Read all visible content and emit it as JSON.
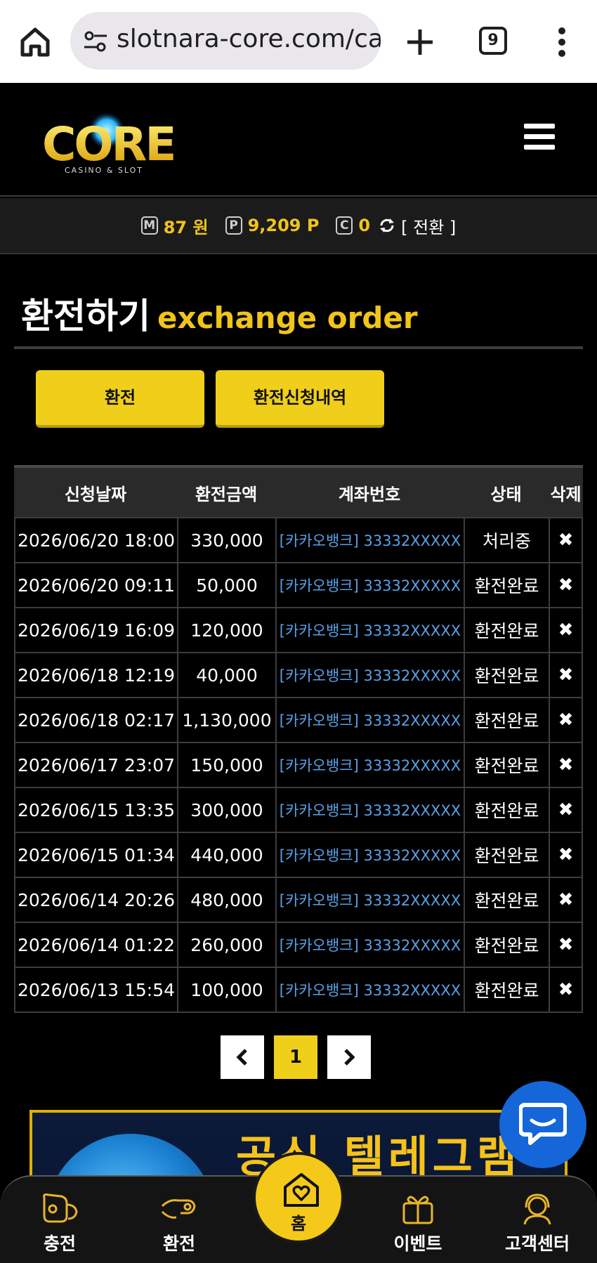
{
  "browser": {
    "url": "slotnara-core.com/ca",
    "tab_count": "9"
  },
  "header": {
    "logo_text": "CORE",
    "logo_sub": "CASINO & SLOT"
  },
  "balance": {
    "money_icon": "M",
    "money": "87 원",
    "point_icon": "P",
    "point": "9,209 P",
    "coin_icon": "C",
    "coin": "0",
    "switch_label": "[ 전환 ]"
  },
  "title": {
    "ko": "환전하기",
    "en": "exchange order"
  },
  "tabs": {
    "exchange": "환전",
    "history": "환전신청내역"
  },
  "table": {
    "headers": [
      "신청날짜",
      "환전금액",
      "계좌번호",
      "상태",
      "삭제"
    ],
    "rows": [
      {
        "date": "2026/06/20 18:00",
        "amount": "330,000",
        "account": "[카카오뱅크] 33332XXXXX",
        "status": "처리중"
      },
      {
        "date": "2026/06/20 09:11",
        "amount": "50,000",
        "account": "[카카오뱅크] 33332XXXXX",
        "status": "환전완료"
      },
      {
        "date": "2026/06/19 16:09",
        "amount": "120,000",
        "account": "[카카오뱅크] 33332XXXXX",
        "status": "환전완료"
      },
      {
        "date": "2026/06/18 12:19",
        "amount": "40,000",
        "account": "[카카오뱅크] 33332XXXXX",
        "status": "환전완료"
      },
      {
        "date": "2026/06/18 02:17",
        "amount": "1,130,000",
        "account": "[카카오뱅크] 33332XXXXX",
        "status": "환전완료"
      },
      {
        "date": "2026/06/17 23:07",
        "amount": "150,000",
        "account": "[카카오뱅크] 33332XXXXX",
        "status": "환전완료"
      },
      {
        "date": "2026/06/15 13:35",
        "amount": "300,000",
        "account": "[카카오뱅크] 33332XXXXX",
        "status": "환전완료"
      },
      {
        "date": "2026/06/15 01:34",
        "amount": "440,000",
        "account": "[카카오뱅크] 33332XXXXX",
        "status": "환전완료"
      },
      {
        "date": "2026/06/14 20:26",
        "amount": "480,000",
        "account": "[카카오뱅크] 33332XXXXX",
        "status": "환전완료"
      },
      {
        "date": "2026/06/14 01:22",
        "amount": "260,000",
        "account": "[카카오뱅크] 33332XXXXX",
        "status": "환전완료"
      },
      {
        "date": "2026/06/13 15:54",
        "amount": "100,000",
        "account": "[카카오뱅크] 33332XXXXX",
        "status": "환전완료"
      }
    ]
  },
  "pagination": {
    "prev": "‹",
    "current": "1",
    "next": "›"
  },
  "banner": {
    "text": "공식 텔레그램"
  },
  "nav": {
    "charge": "충전",
    "exchange": "환전",
    "home": "홈",
    "event": "이벤트",
    "support": "고객센터"
  },
  "colors": {
    "accent": "#f0cf1a",
    "account_link": "#5aa0e6",
    "chat": "#1566d8"
  },
  "icons": [
    "home-icon",
    "site-settings-icon",
    "plus-icon",
    "more-icon",
    "menu-icon",
    "refresh-icon",
    "delete-icon",
    "chat-icon",
    "charge-icon",
    "exchange-icon",
    "heart-home-icon",
    "gift-icon",
    "support-icon"
  ]
}
